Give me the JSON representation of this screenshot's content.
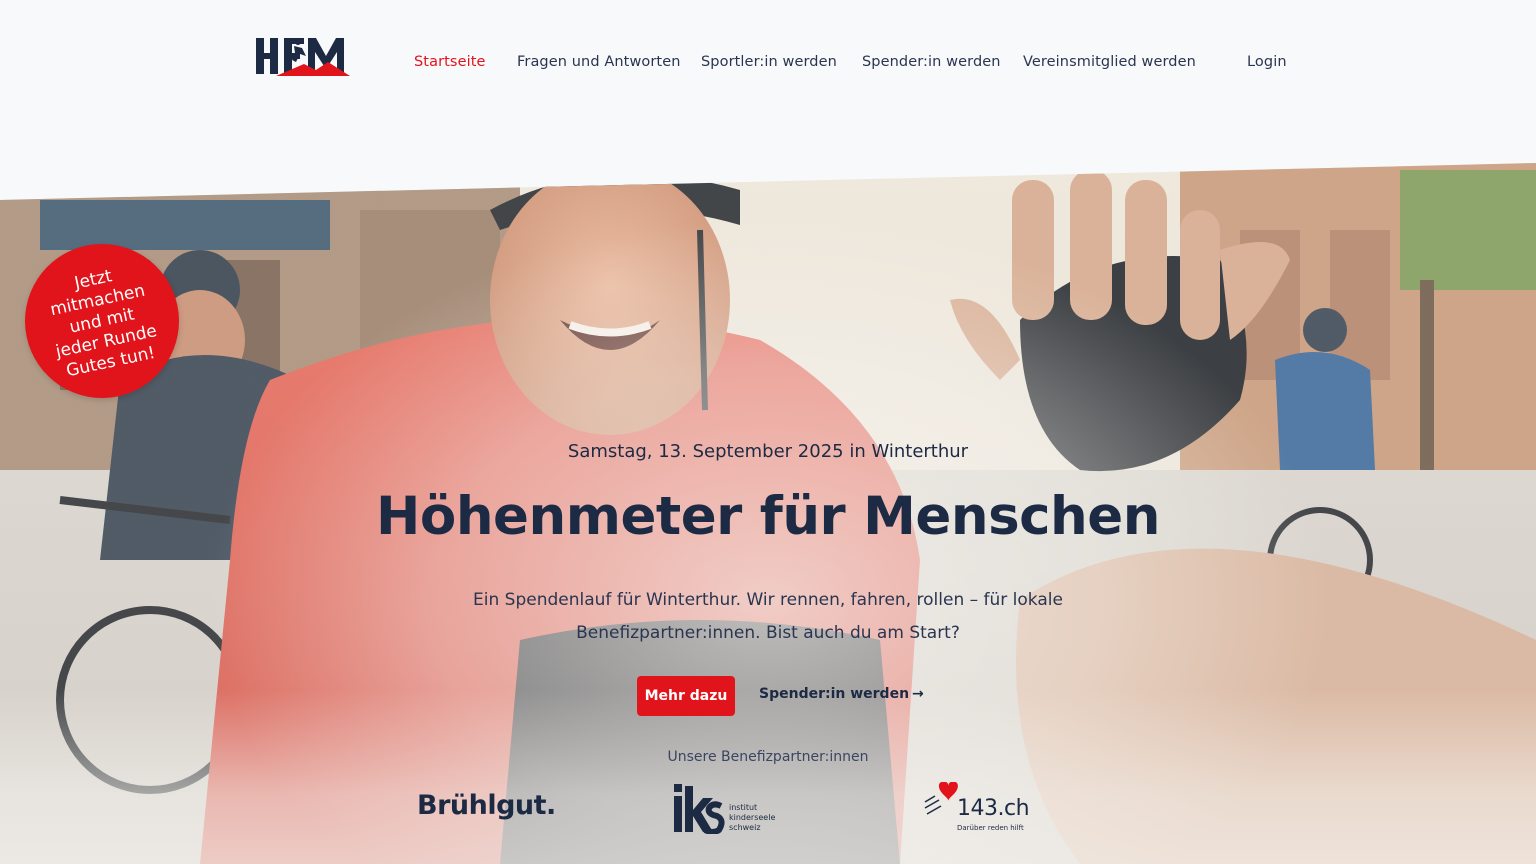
{
  "header": {
    "logo_text": "HFM",
    "nav": [
      {
        "label": "Startseite",
        "active": true
      },
      {
        "label": "Fragen und Antworten",
        "active": false
      },
      {
        "label": "Sportler:in werden",
        "active": false
      },
      {
        "label": "Spender:in werden",
        "active": false
      },
      {
        "label": "Vereinsmitglied werden",
        "active": false
      }
    ],
    "login_label": "Login"
  },
  "badge": {
    "text": "Jetzt\nmitmachen\nund mit\njeder Runde\nGutes tun!"
  },
  "hero": {
    "date_line": "Samstag, 13. September 2025 in Winterthur",
    "title": "Höhenmeter für Menschen",
    "text_line1": "Ein Spendenlauf für Winterthur. Wir rennen, fahren, rollen – für lokale",
    "text_line2": "Benefizpartner:innen. Bist auch du am Start?",
    "primary_button": "Mehr dazu",
    "secondary_link": "Spender:in werden",
    "secondary_arrow": "→"
  },
  "partners": {
    "heading": "Unsere Benefizpartner:innen",
    "bruehlgut": "Brühlgut.",
    "iks_logo": "iks",
    "iks_lines": [
      "institut",
      "kinderseele",
      "schweiz"
    ],
    "p143_name": "143.ch",
    "p143_tagline": "Darüber reden hilft"
  },
  "colors": {
    "accent": "#e2141b",
    "navy": "#1c2a44",
    "page_bg": "#f8f9fb"
  },
  "icons": [
    "hfm-logo-icon",
    "iks-logo-icon",
    "heart-143-icon"
  ]
}
